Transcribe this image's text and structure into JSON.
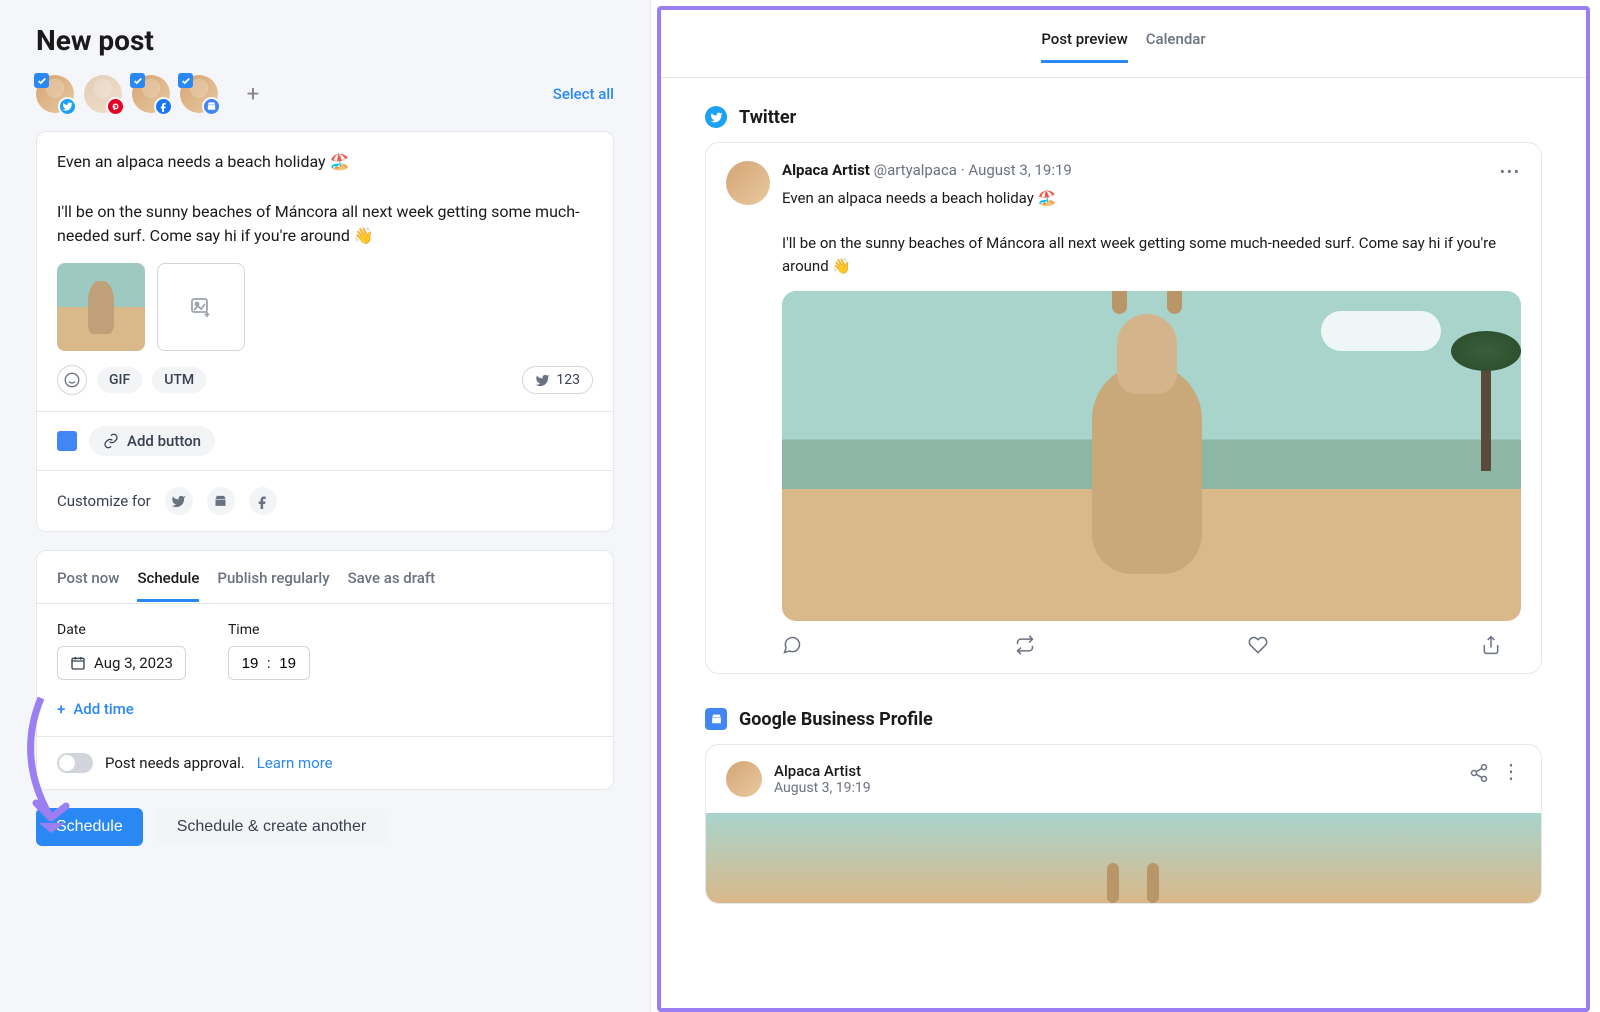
{
  "page": {
    "title": "New post"
  },
  "accounts": {
    "select_all": "Select all",
    "items": [
      {
        "network": "twitter",
        "selected": true
      },
      {
        "network": "pinterest",
        "selected": false
      },
      {
        "network": "facebook",
        "selected": true
      },
      {
        "network": "google-business",
        "selected": true
      }
    ]
  },
  "composer": {
    "text": "Even an alpaca needs a beach holiday 🏖️\n\nI'll be on the sunny beaches of Máncora all next week getting some much-needed surf. Come say hi if you're around 👋",
    "gif_label": "GIF",
    "utm_label": "UTM",
    "char_count": "123",
    "add_button_label": "Add button",
    "customize_label": "Customize for"
  },
  "publish_tabs": {
    "items": [
      "Post now",
      "Schedule",
      "Publish regularly",
      "Save as draft"
    ],
    "active": "Schedule"
  },
  "schedule": {
    "date_label": "Date",
    "time_label": "Time",
    "date_value": "Aug 3, 2023",
    "hour": "19",
    "minute": "19",
    "add_time": "Add time"
  },
  "approval": {
    "label": "Post needs approval.",
    "learn_more": "Learn more"
  },
  "actions": {
    "primary": "Schedule",
    "secondary": "Schedule & create another"
  },
  "preview": {
    "tabs": [
      "Post preview",
      "Calendar"
    ],
    "active": "Post preview",
    "twitter": {
      "heading": "Twitter",
      "name": "Alpaca Artist",
      "handle": "@artyalpaca",
      "separator": "·",
      "timestamp": "August 3, 19:19",
      "text": "Even an alpaca needs a beach holiday 🏖️\n\nI'll be on the sunny beaches of Máncora all next week getting some much-needed surf. Come say hi if you're around 👋"
    },
    "gbp": {
      "heading": "Google Business Profile",
      "name": "Alpaca Artist",
      "timestamp": "August 3, 19:19"
    }
  }
}
